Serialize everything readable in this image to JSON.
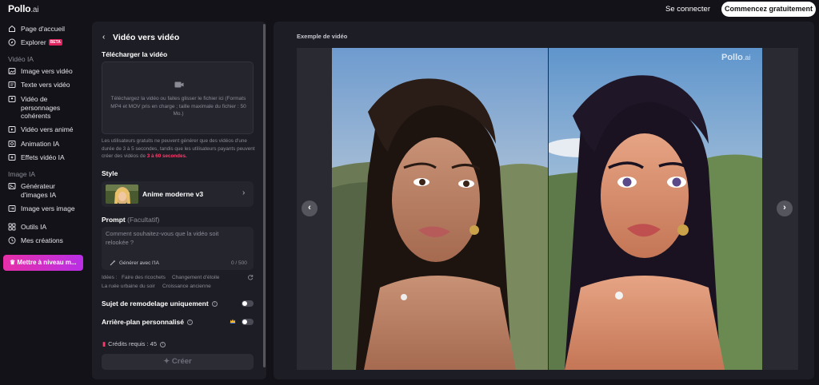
{
  "header": {
    "logo_text": "Pollo",
    "logo_suffix": ".ai",
    "login_label": "Se connecter",
    "start_label": "Commencez gratuitement"
  },
  "nav": {
    "home": "Page d'accueil",
    "explore": "Explorer",
    "beta": "BETA",
    "section_video": "Vidéo IA",
    "image_to_video": "Image vers vidéo",
    "text_to_video": "Texte vers vidéo",
    "consistent_characters": "Vidéo de personnages cohérents",
    "video_to_anime": "Vidéo vers animé",
    "ai_animation": "Animation IA",
    "video_effects": "Effets vidéo IA",
    "section_image": "Image IA",
    "image_generators": "Générateur d'images IA",
    "image_to_image": "Image vers image",
    "ai_tools": "Outils IA",
    "my_creations": "Mes créations",
    "upgrade": "Mettre à niveau m..."
  },
  "panel": {
    "title": "Vidéo vers vidéo",
    "upload_label": "Télécharger la vidéo",
    "upload_text": "Téléchargez la vidéo ou faites glisser le fichier ici (Formats MP4 et MOV pris en charge ; taille maximale du fichier : 50 Mo.)",
    "note_text": "Les utilisateurs gratuits ne peuvent générer que des vidéos d'une durée de 3 à 5 secondes, tandis que les utilisateurs payants peuvent créer des vidéos de ",
    "note_highlight": "3 à 60 secondes.",
    "style_label": "Style",
    "style_name": "Anime moderne v3",
    "prompt_label": "Prompt",
    "prompt_optional": "(Facultatif)",
    "prompt_placeholder": "Comment souhaitez-vous que la vidéo soit relookée ?",
    "generate_ai": "Générer avec l'IA",
    "char_counter": "0 / 500",
    "ideas_label": "Idées :",
    "ideas": [
      "Faire des ricochets",
      "Changement d'étoile",
      "La ruée urbaine du soir",
      "Croissance ancienne"
    ],
    "subject_only": "Sujet de remodelage uniquement",
    "custom_bg": "Arrière-plan personnalisé",
    "subject_only_on": false,
    "custom_bg_on": false,
    "credits": "Crédits requis : 45",
    "create_label": "Créer"
  },
  "preview": {
    "label": "Exemple de vidéo",
    "watermark": "Pollo",
    "watermark_suffix": ".ai"
  },
  "colors": {
    "accent_pink": "#ff3a6b",
    "upgrade_gradient_start": "#e62fa7",
    "upgrade_gradient_end": "#b92fe6",
    "panel_bg": "#1d1d25",
    "page_bg": "#121218"
  }
}
